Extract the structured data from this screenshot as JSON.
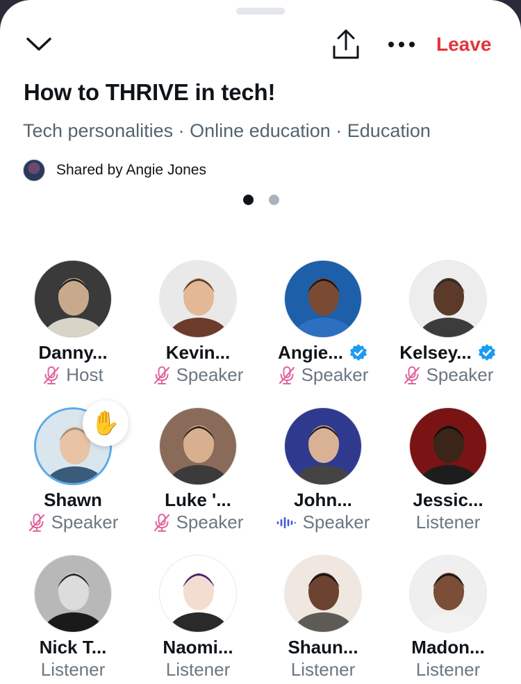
{
  "header": {
    "leave_label": "Leave",
    "collapse_icon": "chevron-down-icon",
    "share_icon": "share-icon",
    "more_icon": "more-icon"
  },
  "space": {
    "title": "How to THRIVE in tech!",
    "topics": [
      "Tech personalities",
      "Online education",
      "Education"
    ],
    "topic_separator": " · ",
    "shared_by": "Shared by Angie Jones"
  },
  "pager": {
    "current": 1,
    "total": 2
  },
  "colors": {
    "leave": "#e0353b",
    "muted_mic": "#e0649e",
    "speaking_wave": "#3f58d6",
    "verified": "#1d9bf0",
    "secondary_text": "#6a7782"
  },
  "participants": [
    {
      "name": "Danny...",
      "role": "Host",
      "status": "muted",
      "verified": false
    },
    {
      "name": "Kevin...",
      "role": "Speaker",
      "status": "muted",
      "verified": false
    },
    {
      "name": "Angie...",
      "role": "Speaker",
      "status": "muted",
      "verified": true
    },
    {
      "name": "Kelsey...",
      "role": "Speaker",
      "status": "muted",
      "verified": true
    },
    {
      "name": "Shawn",
      "role": "Speaker",
      "status": "muted",
      "verified": false,
      "hand_raised": true
    },
    {
      "name": "Luke '...",
      "role": "Speaker",
      "status": "muted",
      "verified": false
    },
    {
      "name": "John...",
      "role": "Speaker",
      "status": "speaking",
      "verified": false
    },
    {
      "name": "Jessic...",
      "role": "Listener",
      "status": "none",
      "verified": false
    },
    {
      "name": "Nick T...",
      "role": "Listener",
      "status": "none",
      "verified": false
    },
    {
      "name": "Naomi...",
      "role": "Listener",
      "status": "none",
      "verified": false
    },
    {
      "name": "Shaun...",
      "role": "Listener",
      "status": "none",
      "verified": false
    },
    {
      "name": "Madon...",
      "role": "Listener",
      "status": "none",
      "verified": false
    }
  ],
  "hand_emoji": "✋"
}
